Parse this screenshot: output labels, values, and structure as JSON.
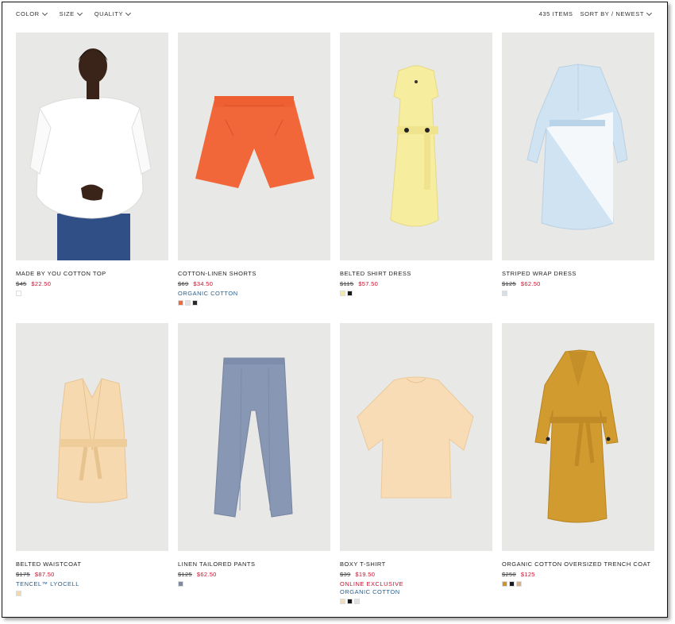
{
  "filters": [
    {
      "label": "COLOR"
    },
    {
      "label": "SIZE"
    },
    {
      "label": "QUALITY"
    }
  ],
  "items_count": "435 ITEMS",
  "sort_label": "SORT BY / NEWEST",
  "products": [
    {
      "name": "MADE BY YOU COTTON TOP",
      "old": "$45",
      "new": "$22.50",
      "tags": [],
      "swatches": [
        "#ffffff"
      ],
      "image": "white-top-model"
    },
    {
      "name": "COTTON-LINEN SHORTS",
      "old": "$69",
      "new": "$34.50",
      "tags": [
        {
          "text": "ORGANIC COTTON",
          "kind": "org"
        }
      ],
      "swatches": [
        "#f06a3c",
        "#e2e2e2",
        "#2a2a2a"
      ],
      "image": "orange-shorts"
    },
    {
      "name": "BELTED SHIRT DRESS",
      "old": "$115",
      "new": "$57.50",
      "tags": [],
      "swatches": [
        "#f5ea9a",
        "#1a1a1a"
      ],
      "image": "yellow-dress"
    },
    {
      "name": "STRIPED WRAP DRESS",
      "old": "$125",
      "new": "$62.50",
      "tags": [],
      "swatches": [
        "#cfe0ee"
      ],
      "image": "blue-wrap-dress"
    },
    {
      "name": "BELTED WAISTCOAT",
      "old": "$175",
      "new": "$87.50",
      "tags": [
        {
          "text": "TENCEL™ LYOCELL",
          "kind": "org"
        }
      ],
      "swatches": [
        "#f4d8a8"
      ],
      "image": "peach-waistcoat"
    },
    {
      "name": "LINEN TAILORED PANTS",
      "old": "$125",
      "new": "$62.50",
      "tags": [],
      "swatches": [
        "#7d8aa6"
      ],
      "image": "blue-pants"
    },
    {
      "name": "BOXY T-SHIRT",
      "old": "$39",
      "new": "$19.50",
      "tags": [
        {
          "text": "ONLINE EXCLUSIVE",
          "kind": "excl"
        },
        {
          "text": "ORGANIC COTTON",
          "kind": "org"
        }
      ],
      "swatches": [
        "#f6dcb6",
        "#1a1a1a",
        "#e2e2e2"
      ],
      "image": "peach-tshirt"
    },
    {
      "name": "ORGANIC COTTON OVERSIZED TRENCH COAT",
      "old": "$250",
      "new": "$125",
      "tags": [],
      "swatches": [
        "#c9962c",
        "#1a1a1a",
        "#d9b08a"
      ],
      "image": "mustard-trench"
    }
  ]
}
